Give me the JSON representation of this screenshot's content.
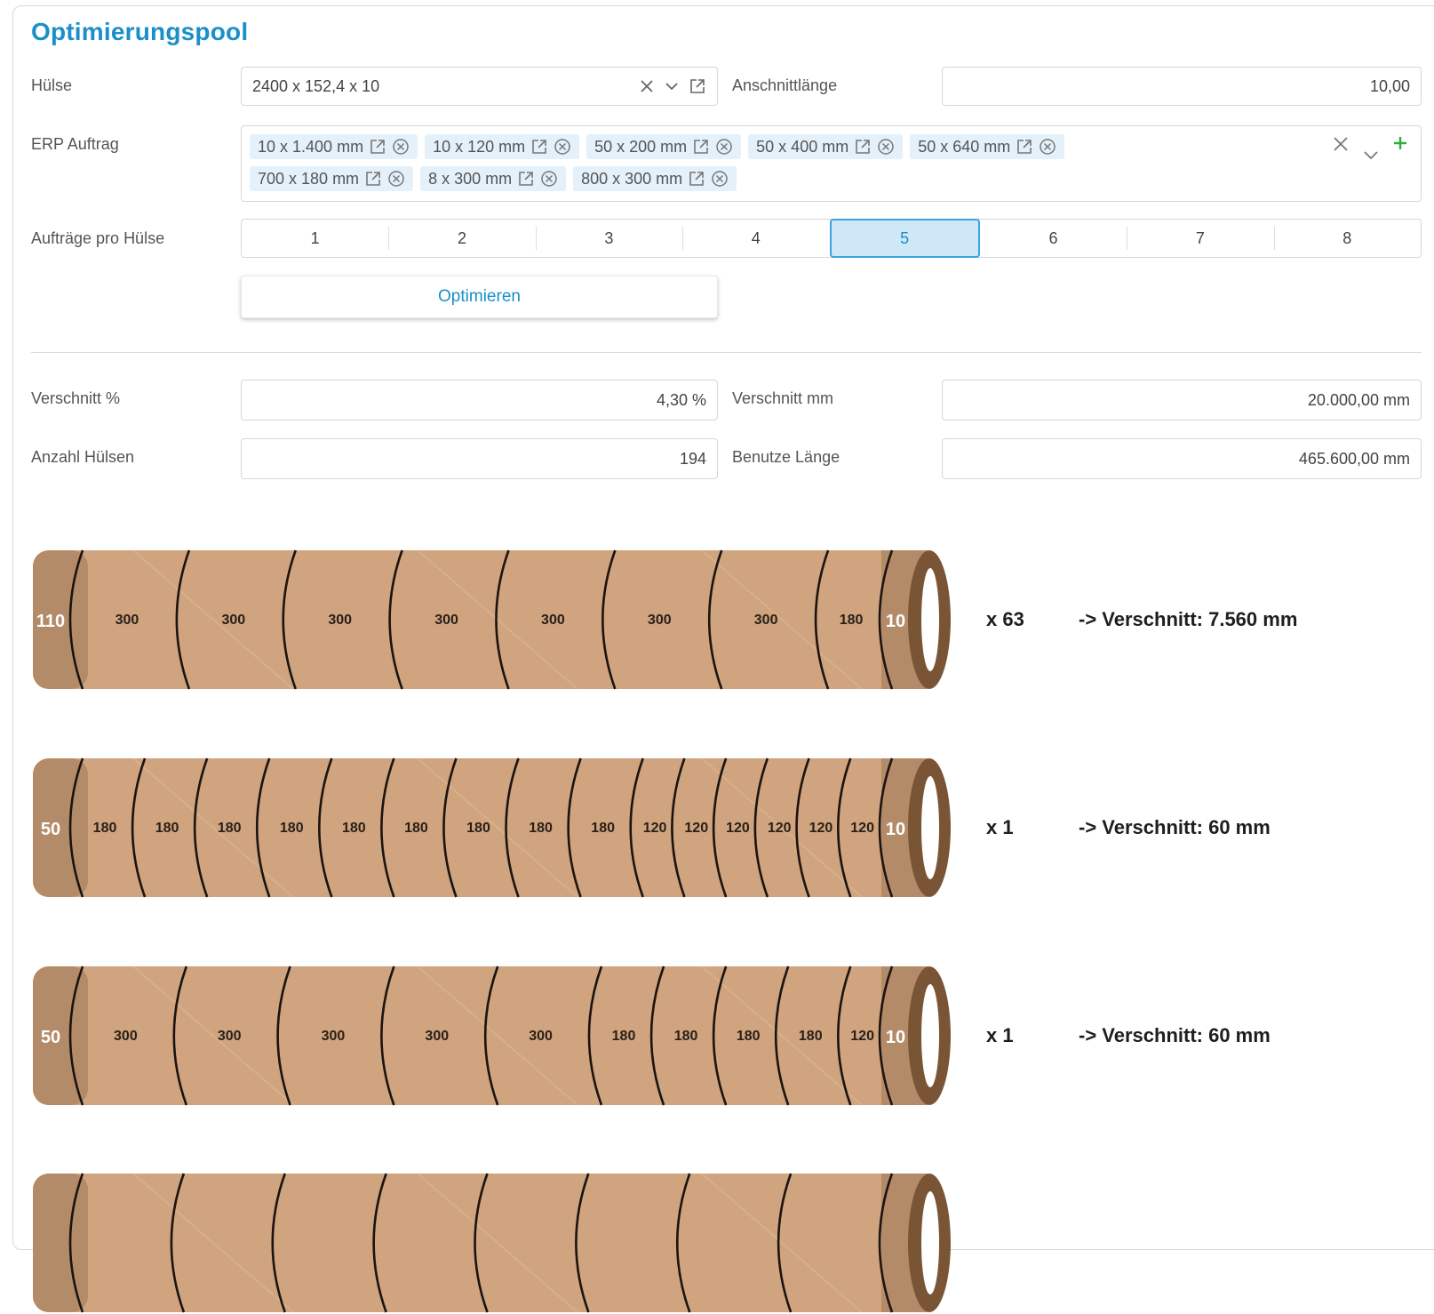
{
  "title": "Optimierungspool",
  "form": {
    "huelse_label": "Hülse",
    "huelse_value": "2400 x 152,4 x 10",
    "anschnitt_label": "Anschnittlänge",
    "anschnitt_value": "10,00",
    "erp_label": "ERP Auftrag",
    "erp_tags": [
      "10 x 1.400 mm",
      "10 x 120 mm",
      "50 x 200 mm",
      "50 x 400 mm",
      "50 x 640 mm",
      "700 x 180 mm",
      "8 x 300 mm",
      "800 x 300 mm"
    ],
    "auftraege_label": "Aufträge pro Hülse",
    "auftraege_options": [
      "1",
      "2",
      "3",
      "4",
      "5",
      "6",
      "7",
      "8"
    ],
    "auftraege_selected": "5",
    "optimize_label": "Optimieren"
  },
  "results": {
    "verschnitt_pct_label": "Verschnitt %",
    "verschnitt_pct_value": "4,30 %",
    "verschnitt_mm_label": "Verschnitt mm",
    "verschnitt_mm_value": "20.000,00 mm",
    "anzahl_label": "Anzahl Hülsen",
    "anzahl_value": "194",
    "laenge_label": "Benutze Länge",
    "laenge_value": "465.600,00 mm"
  },
  "rolls": [
    {
      "trim_left": "110",
      "segments": [
        "300",
        "300",
        "300",
        "300",
        "300",
        "300",
        "300",
        "180"
      ],
      "trim_right": "10",
      "count": "x 63",
      "waste": "-> Verschnitt: 7.560 mm"
    },
    {
      "trim_left": "50",
      "segments": [
        "180",
        "180",
        "180",
        "180",
        "180",
        "180",
        "180",
        "180",
        "180",
        "120",
        "120",
        "120",
        "120",
        "120",
        "120"
      ],
      "trim_right": "10",
      "count": "x 1",
      "waste": "-> Verschnitt: 60 mm"
    },
    {
      "trim_left": "50",
      "segments": [
        "300",
        "300",
        "300",
        "300",
        "300",
        "180",
        "180",
        "180",
        "180",
        "120"
      ],
      "trim_right": "10",
      "count": "x 1",
      "waste": "-> Verschnitt: 60 mm"
    },
    {
      "trim_left": "",
      "segments": [
        "",
        "",
        "",
        "",
        "",
        "",
        "",
        ""
      ],
      "trim_right": "",
      "count": "",
      "waste": ""
    }
  ],
  "colors": {
    "accent": "#1a8fc9",
    "tag_bg": "#e4f1fb",
    "roll_body": "#cfa47f",
    "roll_trim": "#b48b68",
    "roll_end": "#7a5535",
    "add": "#2fae3b"
  },
  "icons": [
    "clear-icon",
    "chevron-down-icon",
    "external-link-icon",
    "remove-circle-icon",
    "plus-icon"
  ]
}
